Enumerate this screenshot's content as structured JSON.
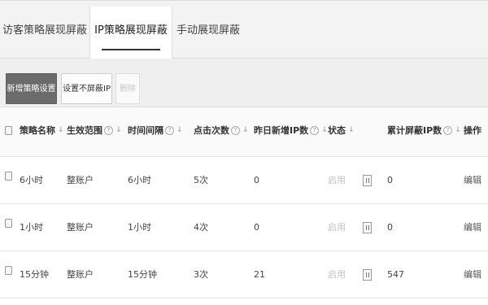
{
  "tabs": [
    {
      "label": "访客策略展现屏蔽",
      "active": false
    },
    {
      "label": "IP策略展现屏蔽",
      "active": true
    },
    {
      "label": "手动展现屏蔽",
      "active": false
    }
  ],
  "toolbar": {
    "add_label": "新增策略设置",
    "set_label": "设置不屏蔽IP",
    "delete_label": "删除"
  },
  "table": {
    "columns": {
      "name": "策略名称",
      "scope": "生效范围",
      "interval": "时间间隔",
      "clicks": "点击次数",
      "new_ip": "昨日新增IP数",
      "status": "状态",
      "total_ip": "累计屏蔽IP数",
      "action": "操作"
    },
    "rows": [
      {
        "name": "6小时",
        "scope": "整账户",
        "interval": "6小时",
        "clicks": "5次",
        "new_ip": "0",
        "status": "启用",
        "total_ip": "0",
        "action": "编辑"
      },
      {
        "name": "1小时",
        "scope": "整账户",
        "interval": "1小时",
        "clicks": "4次",
        "new_ip": "0",
        "status": "启用",
        "total_ip": "0",
        "action": "编辑"
      },
      {
        "name": "15分钟",
        "scope": "整账户",
        "interval": "15分钟",
        "clicks": "3次",
        "new_ip": "21",
        "status": "启用",
        "total_ip": "547",
        "action": "编辑"
      }
    ]
  },
  "icons": {
    "sort": "sort-arrow-icon",
    "help": "help-icon",
    "pause": "pause-icon"
  },
  "colors": {
    "primary_button": "#6b6b6b",
    "tab_bar": "#f3f3f3",
    "toolbar": "#efefef"
  }
}
